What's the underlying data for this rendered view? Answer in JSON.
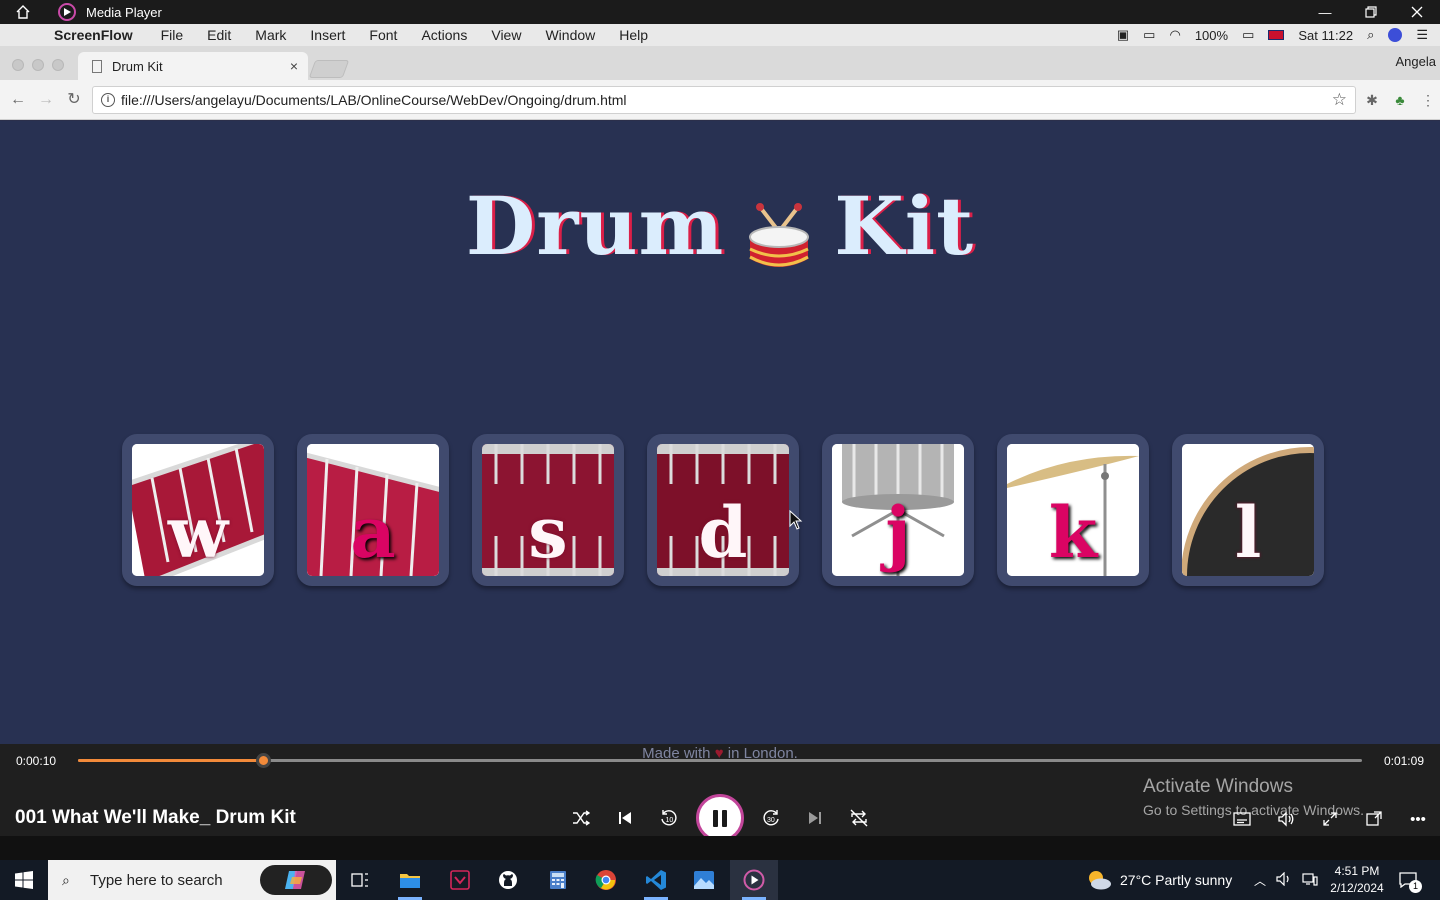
{
  "player": {
    "app_title": "Media Player",
    "track_title": "001 What We'll Make_ Drum Kit",
    "time_current": "0:00:10",
    "time_total": "0:01:09",
    "progress": 0.144,
    "accent_color": "#f28a3a"
  },
  "mac_menubar": {
    "app_name": "ScreenFlow",
    "items": [
      "File",
      "Edit",
      "Mark",
      "Insert",
      "Font",
      "Actions",
      "View",
      "Window",
      "Help"
    ],
    "battery": "100%",
    "clock": "Sat 11:22"
  },
  "browser": {
    "tab_title": "Drum Kit",
    "profile": "Angela",
    "url": "file:///Users/angelayu/Documents/LAB/OnlineCourse/WebDev/Ongoing/drum.html"
  },
  "page": {
    "title_left": "Drum",
    "title_right": "Kit",
    "footer_before": "Made with",
    "footer_after": "in London.",
    "drums": [
      {
        "key": "w",
        "kind": "tom-1"
      },
      {
        "key": "a",
        "kind": "tom-2"
      },
      {
        "key": "s",
        "kind": "tom-3"
      },
      {
        "key": "d",
        "kind": "tom-4"
      },
      {
        "key": "j",
        "kind": "snare"
      },
      {
        "key": "k",
        "kind": "crash"
      },
      {
        "key": "l",
        "kind": "kick"
      }
    ]
  },
  "watermark": {
    "line1": "Activate Windows",
    "line2": "Go to Settings to activate Windows."
  },
  "taskbar": {
    "search_placeholder": "Type here to search",
    "weather": "27°C  Partly sunny",
    "time": "4:51 PM",
    "date": "2/12/2024",
    "notification_count": "1"
  }
}
